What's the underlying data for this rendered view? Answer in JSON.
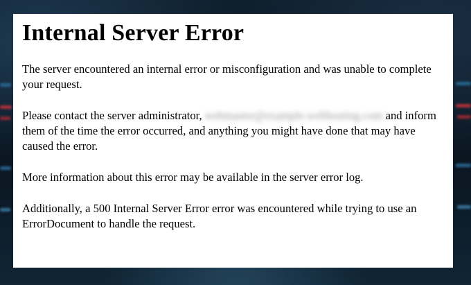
{
  "page": {
    "heading": "Internal Server Error",
    "paragraph_1": "The server encountered an internal error or misconfiguration and was unable to complete your request.",
    "paragraph_2_before": "Please contact the server administrator,",
    "paragraph_2_email": "webmaster@example.webhosting.com",
    "paragraph_2_after": "and inform them of the time the error occurred, and anything you might have done that may have caused the error.",
    "paragraph_3": "More information about this error may be available in the server error log.",
    "paragraph_4": "Additionally, a 500 Internal Server Error error was encountered while trying to use an ErrorDocument to handle the request."
  },
  "colors": {
    "panel_background": "#ffffff",
    "text": "#000000",
    "backdrop_dark": "#0b1622",
    "backdrop_red": "#c8323c",
    "backdrop_blue": "#2a6f9c"
  }
}
